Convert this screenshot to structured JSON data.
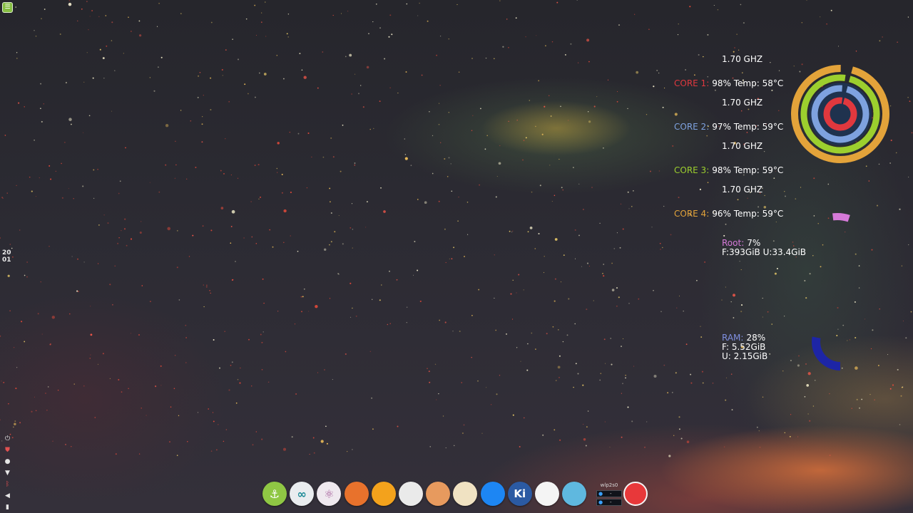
{
  "desktop": {
    "clock": {
      "hour": "20",
      "minute": "01"
    },
    "menu_icon": "linux-mint-menu-icon",
    "tray_icons": [
      "power-icon",
      "shield-icon",
      "user-icon",
      "wifi-icon",
      "bluetooth-icon",
      "volume-mute-icon",
      "battery-icon"
    ]
  },
  "conky": {
    "cores": [
      {
        "freq": "1.70 GHZ",
        "label": "CORE 1:",
        "usage": "98%",
        "temp": "Temp: 58°C",
        "color": "#e0383e"
      },
      {
        "freq": "1.70 GHZ",
        "label": "CORE 2:",
        "usage": "97%",
        "temp": "Temp: 59°C",
        "color": "#7ea2df"
      },
      {
        "freq": "1.70 GHZ",
        "label": "CORE 3:",
        "usage": "98%",
        "temp": "Temp: 59°C",
        "color": "#9ccf2e"
      },
      {
        "freq": "1.70 GHZ",
        "label": "CORE 4:",
        "usage": "96%",
        "temp": "Temp: 59°C",
        "color": "#e3a33a"
      }
    ],
    "root": {
      "label": "Root:",
      "percent": "7%",
      "detail": "F:393GiB U:33.4GiB",
      "fraction": 0.07,
      "color": "#d57ad8"
    },
    "ram": {
      "label": "RAM:",
      "percent": "28%",
      "free": "F: 5.52GiB",
      "used": "U: 2.15GiB",
      "fraction": 0.28,
      "color": "#1d25a6"
    }
  },
  "dock": {
    "items": [
      {
        "name": "anchor-app-icon",
        "glyph": "⚓",
        "color": "#8fc744"
      },
      {
        "name": "arduino-icon",
        "glyph": "∞",
        "color": "#e9ecef"
      },
      {
        "name": "atom-editor-icon",
        "glyph": "⚛",
        "color": "#efe9ef"
      },
      {
        "name": "firefox-icon",
        "glyph": "",
        "color": "#e8722c"
      },
      {
        "name": "files-folder-icon",
        "glyph": "",
        "color": "#f3a21c"
      },
      {
        "name": "eraser-app-icon",
        "glyph": "",
        "color": "#eaeaea"
      },
      {
        "name": "speaker-app-icon",
        "glyph": "",
        "color": "#e79a5e"
      },
      {
        "name": "shopping-bag-app-icon",
        "glyph": "",
        "color": "#f0e2c2"
      },
      {
        "name": "messenger-icon",
        "glyph": "",
        "color": "#1d86f3"
      },
      {
        "name": "kicad-icon",
        "glyph": "Ki",
        "color": "#2b5aa3"
      },
      {
        "name": "pdf-reader-icon",
        "glyph": "",
        "color": "#f4f4f4"
      },
      {
        "name": "calculator-icon",
        "glyph": "",
        "color": "#5fb8df"
      }
    ],
    "network_widget": {
      "interface": "wlp2s0",
      "up_label": "-",
      "down_label": "-"
    },
    "record_button_color": "#e8383a"
  }
}
